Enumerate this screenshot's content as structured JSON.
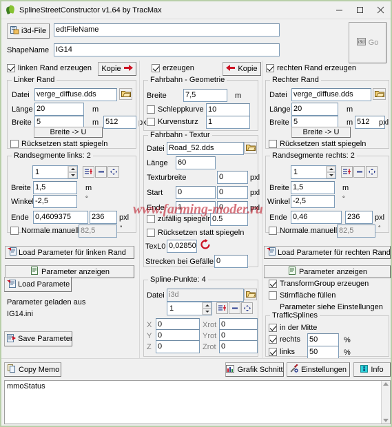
{
  "window": {
    "title": "SplineStreetConstructor v1.64 by TracMax",
    "icon": "leaf-icon",
    "minimize": "minimize-icon",
    "maximize": "maximize-icon",
    "close": "close-icon"
  },
  "top": {
    "i3d_file_button": "i3d-File",
    "i3d_file_value": "edtFileName",
    "shapename_label": "ShapeName",
    "shapename_value": "IG14",
    "go_button": "Go",
    "go_disabled": true
  },
  "left": {
    "create_checkbox": "linken Rand erzeugen",
    "create_checked": true,
    "copy_button": "Kopie",
    "copy_arrow": "arrow-right-red-icon",
    "group_title": "Linker Rand",
    "datei_label": "Datei",
    "datei_value": "verge_diffuse.dds",
    "laenge_label": "Länge",
    "laenge_value": "20",
    "laenge_unit": "m",
    "breite_label": "Breite",
    "breite_value": "5",
    "breite_unit": "m",
    "breite_px_value": "512",
    "breite_px_unit": "pxl",
    "breite_u_button": "Breite -> U",
    "ruecksetzen_checkbox": "Rücksetzen statt spiegeln",
    "ruecksetzen_checked": false,
    "seg_group_title": "Randsegmente links: 2",
    "seg_index": "1",
    "seg_add_icon": "add-row-icon",
    "seg_remove_icon": "minus-icon",
    "seg_move_icon": "move-icon",
    "seg_breite_label": "Breite",
    "seg_breite_value": "1,5",
    "seg_breite_unit": "m",
    "seg_winkel_label": "Winkel",
    "seg_winkel_value": "-2,5",
    "seg_winkel_unit": "°",
    "seg_ende_label": "Ende",
    "seg_ende_value": "0,4609375",
    "seg_ende_px": "236",
    "seg_ende_px_unit": "pxl",
    "normale_checkbox": "Normale manuell",
    "normale_checked": false,
    "normale_value": "82,5",
    "normale_unit": "°",
    "load_param_button": "Load Parameter für linken Rand",
    "load_param_icon": "load-doc-icon",
    "show_param_button": "Parameter anzeigen",
    "show_param_icon": "doc-icon",
    "load_parameter_button": "Load Paramete",
    "loaded_line1": "Parameter geladen aus",
    "loaded_line2": "IG14.ini",
    "save_parameter_button": "Save Parameter",
    "save_icon": "save-doc-icon"
  },
  "middle": {
    "create_checkbox": "erzeugen",
    "create_checked": true,
    "copy_button": "Kopie",
    "copy_arrow": "arrow-left-red-icon",
    "geo_group_title": "Fahrbahn - Geometrie",
    "geo_breite_label": "Breite",
    "geo_breite_value": "7,5",
    "geo_breite_unit": "m",
    "schleppkurve_checkbox": "Schleppkurve",
    "schleppkurve_checked": false,
    "schleppkurve_value": "10",
    "kurvensturz_checkbox": "Kurvensturz",
    "kurvensturz_checked": false,
    "kurvensturz_value": "1",
    "tex_group_title": "Fahrbahn - Textur",
    "tex_datei_label": "Datei",
    "tex_datei_value": "Road_52.dds",
    "tex_laenge_label": "Länge",
    "tex_laenge_value": "60",
    "texturbreite_label": "Texturbreite",
    "texturbreite_value": "0",
    "texturbreite_unit": "pxl",
    "start_label": "Start",
    "start_value": "0",
    "start_px": "0",
    "start_unit": "pxl",
    "ende_label": "Ende",
    "ende_value": "1",
    "ende_px": "0",
    "ende_unit": "pxl",
    "zufaellig_checkbox": "zufällig spiegeln",
    "zufaellig_checked": false,
    "zufaellig_value": "0.5",
    "ruecksetzen_checkbox": "Rücksetzen statt spiegeln",
    "ruecksetzen_checked": false,
    "texl0_label": "TexL0",
    "texl0_value": "0,028501",
    "texl0_refresh_icon": "refresh-red-icon",
    "strecken_label": "Strecken bei Gefälle",
    "strecken_value": "0",
    "spline_group_title": "Spline-Punkte: 4",
    "spline_datei_label": "Datei",
    "spline_datei_value": "i3d",
    "spline_index": "1",
    "spline_add_icon": "add-row-icon",
    "spline_remove_icon": "minus-icon",
    "spline_move_icon": "move-icon",
    "x_label": "X",
    "x_value": "0",
    "y_label": "Y",
    "y_value": "0",
    "z_label": "Z",
    "z_value": "0",
    "xrot_label": "Xrot",
    "xrot_value": "0",
    "yrot_label": "Yrot",
    "yrot_value": "0",
    "zrot_label": "Zrot",
    "zrot_value": "0"
  },
  "right": {
    "create_checkbox": "rechten Rand erzeugen",
    "create_checked": true,
    "group_title": "Rechter Rand",
    "datei_label": "Datei",
    "datei_value": "verge_diffuse.dds",
    "laenge_label": "Länge",
    "laenge_value": "20",
    "laenge_unit": "m",
    "breite_label": "Breite",
    "breite_value": "5",
    "breite_unit": "m",
    "breite_px_value": "512",
    "breite_px_unit": "pxl",
    "breite_u_button": "Breite -> U",
    "ruecksetzen_checkbox": "Rücksetzen statt spiegeln",
    "ruecksetzen_checked": false,
    "seg_group_title": "Randsegmente rechts: 2",
    "seg_index": "1",
    "seg_breite_label": "Breite",
    "seg_breite_value": "1,5",
    "seg_breite_unit": "m",
    "seg_winkel_label": "Winkel",
    "seg_winkel_value": "-2,5",
    "seg_winkel_unit": "°",
    "seg_ende_label": "Ende",
    "seg_ende_value": "0,46",
    "seg_ende_px": "236",
    "seg_ende_px_unit": "pxl",
    "normale_checkbox": "Normale manuell",
    "normale_checked": false,
    "normale_value": "82,5",
    "normale_unit": "°",
    "load_param_button": "Load Parameter für rechten Rand",
    "show_param_button": "Parameter anzeigen",
    "transformgroup_checkbox": "TransformGroup erzeugen",
    "transformgroup_checked": true,
    "stirnflaeche_checkbox": "Stirnfläche füllen",
    "stirnflaeche_checked": false,
    "hint_text": "Parameter siehe Einstellungen",
    "traffic_group_title": "TrafficSplines",
    "mitte_checkbox": "in der Mitte",
    "mitte_checked": true,
    "rechts_checkbox": "rechts",
    "rechts_checked": true,
    "rechts_value": "50",
    "rechts_unit": "%",
    "links_checkbox": "links",
    "links_checked": true,
    "links_value": "50",
    "links_unit": "%"
  },
  "bottom": {
    "copy_memo_button": "Copy Memo",
    "copy_memo_icon": "copy-icon",
    "grafik_schnitt_button": "Grafik Schnitt",
    "grafik_schnitt_icon": "chart-icon",
    "einstellungen_button": "Einstellungen",
    "einstellungen_icon": "tools-icon",
    "info_button": "Info",
    "info_icon": "info-icon",
    "status_memo": "mmoStatus"
  },
  "watermark": "www.farming-moder.ru",
  "colors": {
    "accent_red": "#be1e2d",
    "window_border": "#b8cfa8",
    "face": "#f0f0f0",
    "field_border": "#7f9db9"
  }
}
